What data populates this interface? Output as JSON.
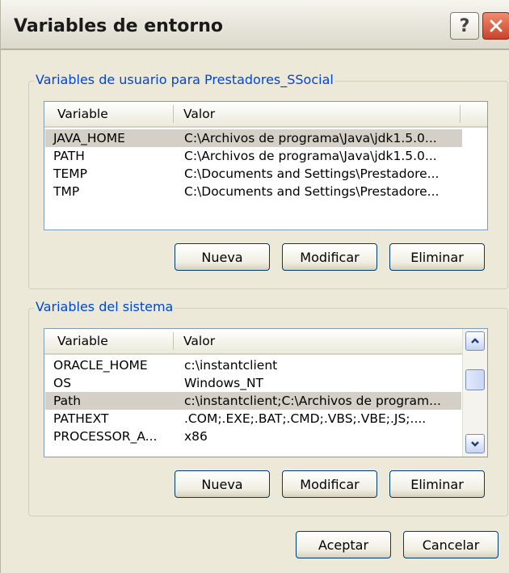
{
  "window": {
    "title": "Variables de entorno"
  },
  "titlebar": {
    "help_label": "?"
  },
  "user_vars": {
    "legend": "Variables de usuario para Prestadores_SSocial",
    "col_variable": "Variable",
    "col_valor": "Valor",
    "rows": [
      {
        "name": "JAVA_HOME",
        "value": "C:\\Archivos de programa\\Java\\jdk1.5.0...",
        "selected": true
      },
      {
        "name": "PATH",
        "value": "C:\\Archivos de programa\\Java\\jdk1.5.0..."
      },
      {
        "name": "TEMP",
        "value": "C:\\Documents and Settings\\Prestadore..."
      },
      {
        "name": "TMP",
        "value": "C:\\Documents and Settings\\Prestadore..."
      }
    ],
    "btn_new": "Nueva",
    "btn_edit": "Modificar",
    "btn_delete": "Eliminar"
  },
  "system_vars": {
    "legend": "Variables del sistema",
    "col_variable": "Variable",
    "col_valor": "Valor",
    "rows": [
      {
        "name": "ORACLE_HOME",
        "value": "c:\\instantclient"
      },
      {
        "name": "OS",
        "value": "Windows_NT"
      },
      {
        "name": "Path",
        "value": "c:\\instantclient;C:\\Archivos de program...",
        "selected": true
      },
      {
        "name": "PATHEXT",
        "value": ".COM;.EXE;.BAT;.CMD;.VBS;.VBE;.JS;...."
      },
      {
        "name": "PROCESSOR_A...",
        "value": "x86"
      }
    ],
    "btn_new": "Nueva",
    "btn_edit": "Modificar",
    "btn_delete": "Eliminar"
  },
  "footer": {
    "ok_label": "Aceptar",
    "cancel_label": "Cancelar"
  }
}
